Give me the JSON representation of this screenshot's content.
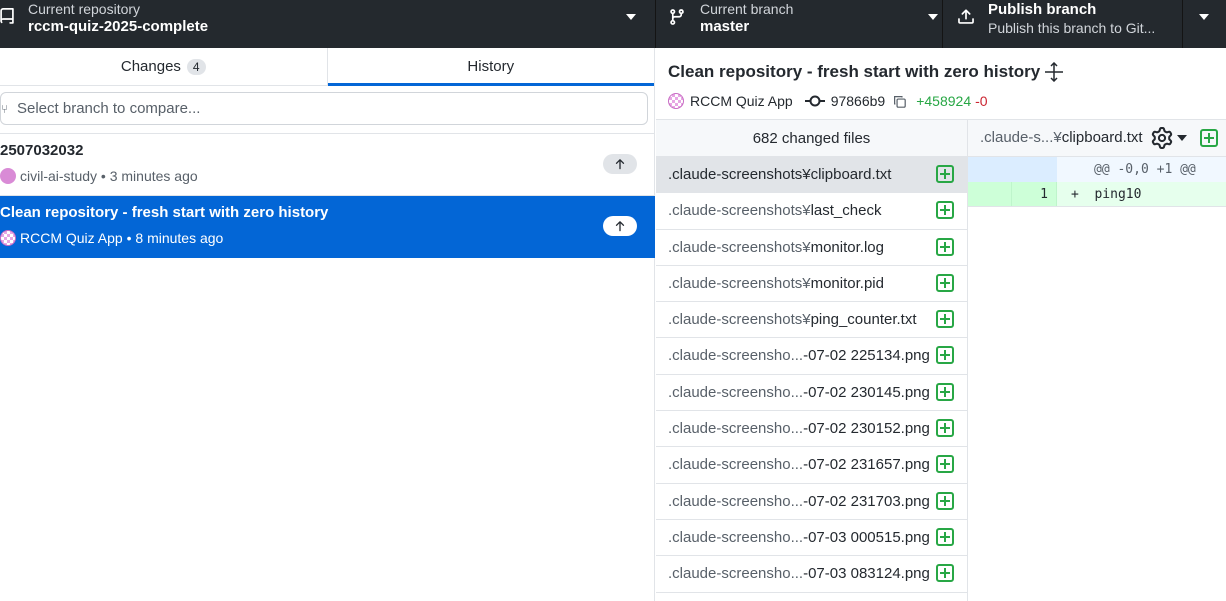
{
  "toolbar": {
    "repo_label": "Current repository",
    "repo_name": "rccm-quiz-2025-complete",
    "branch_label": "Current branch",
    "branch_name": "master",
    "publish_label": "Publish branch",
    "publish_desc": "Publish this branch to Git..."
  },
  "tabs": {
    "changes_label": "Changes",
    "changes_count": "4",
    "history_label": "History"
  },
  "compare": {
    "placeholder": "Select branch to compare..."
  },
  "commits": [
    {
      "title": "2507032032",
      "author": "civil-ai-study",
      "time": "3 minutes ago"
    },
    {
      "title": "Clean repository - fresh start with zero history",
      "author": "RCCM Quiz App",
      "time": "8 minutes ago"
    }
  ],
  "detail": {
    "title": "Clean repository - fresh start with zero history",
    "author": "RCCM Quiz App",
    "sha": "97866b9",
    "additions": "+458924",
    "deletions": "-0"
  },
  "files": {
    "header": "682 changed files",
    "items": [
      {
        "dir": ".claude-screenshots¥",
        "name": "clipboard.txt"
      },
      {
        "dir": ".claude-screenshots¥",
        "name": "last_check"
      },
      {
        "dir": ".claude-screenshots¥",
        "name": "monitor.log"
      },
      {
        "dir": ".claude-screenshots¥",
        "name": "monitor.pid"
      },
      {
        "dir": ".claude-screenshots¥",
        "name": "ping_counter.txt"
      },
      {
        "dir": ".claude-screensho...",
        "name": "-07-02 225134.png"
      },
      {
        "dir": ".claude-screensho...",
        "name": "-07-02 230145.png"
      },
      {
        "dir": ".claude-screensho...",
        "name": "-07-02 230152.png"
      },
      {
        "dir": ".claude-screensho...",
        "name": "-07-02 231657.png"
      },
      {
        "dir": ".claude-screensho...",
        "name": "-07-02 231703.png"
      },
      {
        "dir": ".claude-screensho...",
        "name": "-07-03 000515.png"
      },
      {
        "dir": ".claude-screensho...",
        "name": "-07-03 083124.png"
      }
    ]
  },
  "diff": {
    "path_dir": ".claude-s...¥",
    "path_name": "clipboard.txt",
    "hunk": "@@ -0,0 +1 @@",
    "line_no": "1",
    "line_text": "+  ping10"
  },
  "colors": {
    "accent": "#0366d6",
    "toolbar_bg": "#24292e",
    "added": "#28a745",
    "deleted": "#cb2431"
  }
}
